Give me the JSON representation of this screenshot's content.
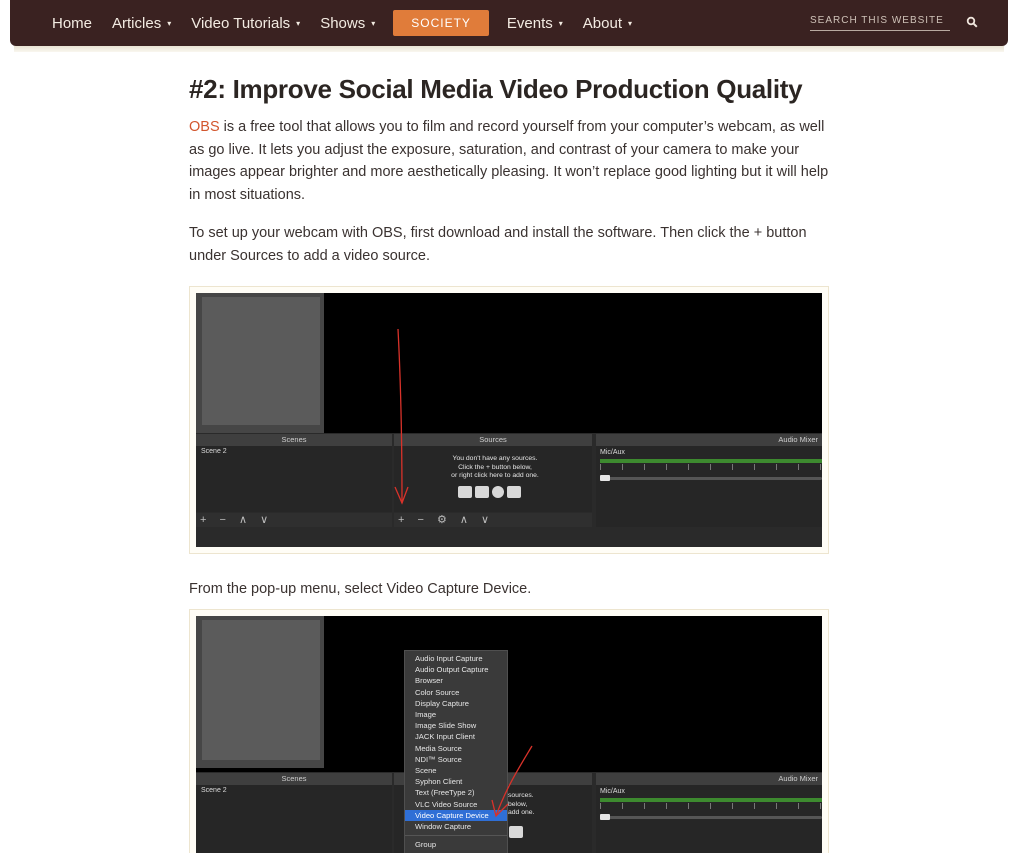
{
  "nav": {
    "items": [
      {
        "label": "Home",
        "has_caret": false
      },
      {
        "label": "Articles",
        "has_caret": true
      },
      {
        "label": "Video Tutorials",
        "has_caret": true
      },
      {
        "label": "Shows",
        "has_caret": true
      },
      {
        "label": "SOCIETY",
        "highlight": true
      },
      {
        "label": "Events",
        "has_caret": true
      },
      {
        "label": "About",
        "has_caret": true
      }
    ],
    "caret": "▾",
    "search_placeholder": "SEARCH THIS WEBSITE",
    "colors": {
      "bar": "#3a2221",
      "society": "#e07c3a"
    }
  },
  "article": {
    "title": "#2: Improve Social Media Video Production Quality",
    "p1_link": "OBS",
    "p1_rest": " is a free tool that allows you to film and record yourself from your computer’s webcam, as well as go live. It lets you adjust the exposure, saturation, and contrast of your camera to make your images appear brighter and more aesthetically pleasing. It won’t replace good lighting but it will help in most situations.",
    "p2": "To set up your webcam with OBS, first download and install the software. Then click the + button under Sources to add a video source.",
    "p3": "From the pop-up menu, select Video Capture Device.",
    "link_color": "#d2562e"
  },
  "obs1": {
    "scenes_title": "Scenes",
    "sources_title": "Sources",
    "mixer_title": "Audio Mixer",
    "scene_item": "Scene 2",
    "sources_msg_1": "You don't have any sources.",
    "sources_msg_2": "Click the + button below,",
    "sources_msg_3": "or right click here to add one.",
    "mixer_channel": "Mic/Aux",
    "scenes_toolbar": "+ − ∧ ∨",
    "sources_toolbar": "+ − ⚙ ∧ ∨"
  },
  "obs2": {
    "scenes_title": "Scenes",
    "mixer_title": "Audio Mixer",
    "scene_item": "Scene 2",
    "mixer_channel": "Mic/Aux",
    "sources_msg_1": "sources.",
    "sources_msg_2": "below,",
    "sources_msg_3": "add one.",
    "menu_items": [
      "Audio Input Capture",
      "Audio Output Capture",
      "Browser",
      "Color Source",
      "Display Capture",
      "Image",
      "Image Slide Show",
      "JACK Input Client",
      "Media Source",
      "NDI™ Source",
      "Scene",
      "Syphon Client",
      "Text (FreeType 2)",
      "VLC Video Source",
      "Video Capture Device",
      "Window Capture"
    ],
    "menu_selected": "Video Capture Device",
    "menu_group": "Group"
  }
}
